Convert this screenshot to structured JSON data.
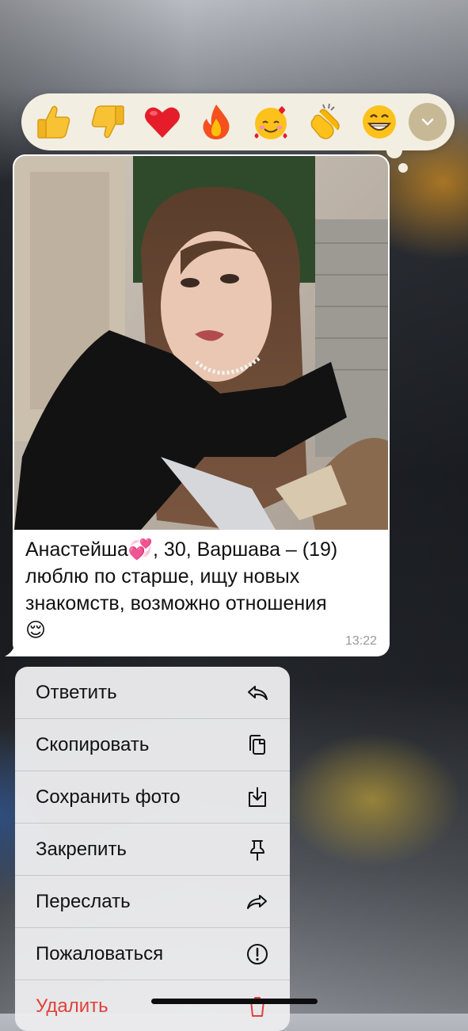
{
  "reactions": [
    {
      "name": "thumbs-up",
      "glyph": "👍"
    },
    {
      "name": "thumbs-down",
      "glyph": "👎"
    },
    {
      "name": "red-heart",
      "glyph": "❤"
    },
    {
      "name": "fire",
      "glyph": "🔥"
    },
    {
      "name": "smiling-face-with-hearts",
      "glyph": "🥰"
    },
    {
      "name": "clapping-hands",
      "glyph": "👏"
    },
    {
      "name": "beaming-face",
      "glyph": "😁"
    }
  ],
  "message": {
    "text_line1_name": "Анастейша",
    "text_line1_emoji": "💞",
    "text_line1_rest": ", 30, Варшава – (19)",
    "text_line2": "люблю по старше, ищу новых",
    "text_line3": "знакомств, возможно отношения",
    "text_emoji": "😌",
    "time": "13:22"
  },
  "menu": {
    "items": [
      {
        "label": "Ответить",
        "icon": "reply-icon"
      },
      {
        "label": "Скопировать",
        "icon": "copy-icon"
      },
      {
        "label": "Сохранить фото",
        "icon": "save-photo-icon"
      },
      {
        "label": "Закрепить",
        "icon": "pin-icon"
      },
      {
        "label": "Переслать",
        "icon": "forward-icon"
      },
      {
        "label": "Пожаловаться",
        "icon": "report-icon"
      },
      {
        "label": "Удалить",
        "icon": "trash-icon"
      }
    ]
  },
  "colors": {
    "reaction_bar_bg": "#f2eee2",
    "expand_button": "#c7b995",
    "delete_red": "#e0413a",
    "bubble_bg": "#ffffff"
  }
}
